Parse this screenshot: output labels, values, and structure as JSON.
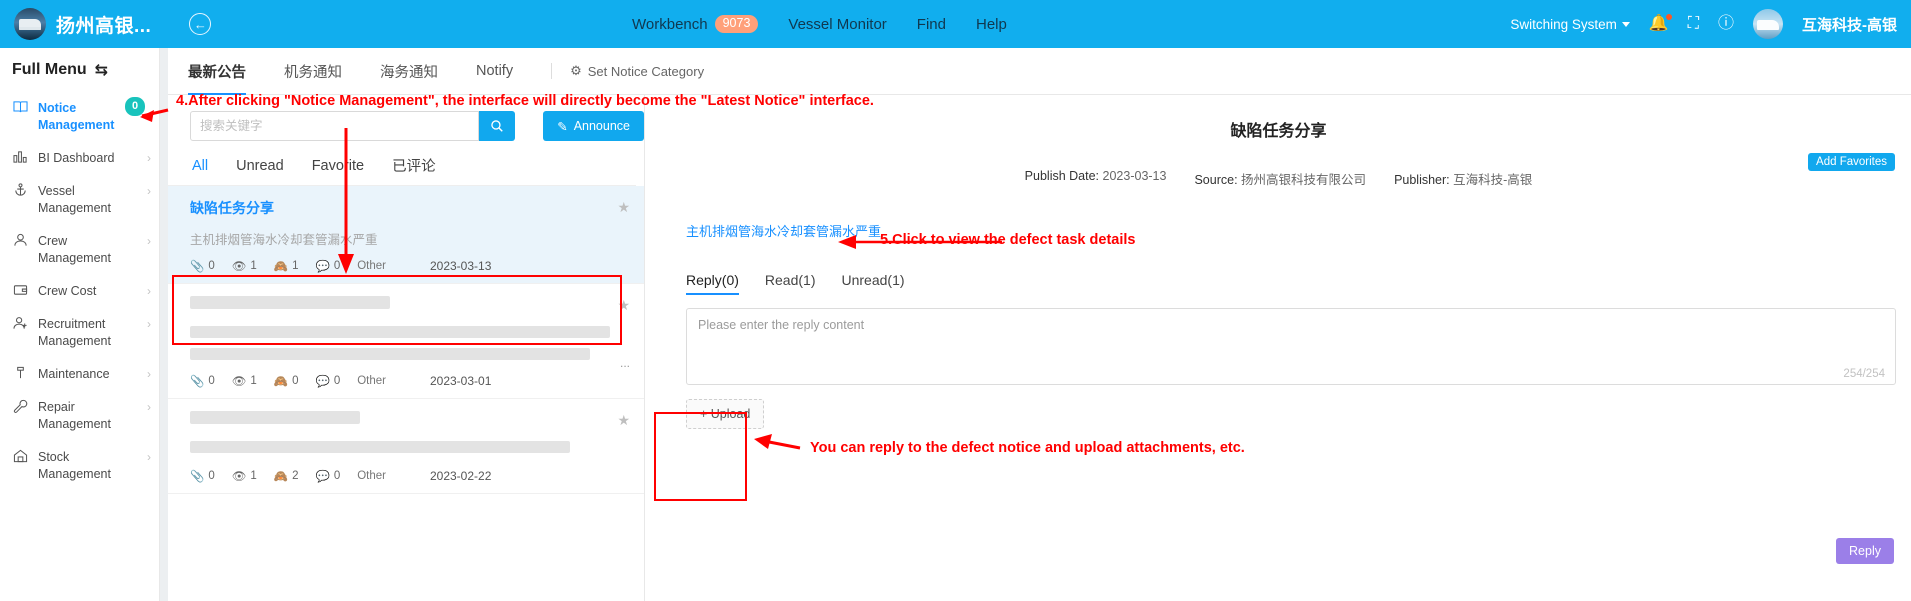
{
  "header": {
    "brand_name": "扬州高银...",
    "logo_icon": "ship-logo",
    "back_icon": "back-arrow-icon",
    "nav": [
      {
        "label": "Workbench",
        "badge": "9073"
      },
      {
        "label": "Vessel Monitor",
        "badge": ""
      },
      {
        "label": "Find",
        "badge": ""
      },
      {
        "label": "Help",
        "badge": ""
      }
    ],
    "switching_system": "Switching System",
    "bell_icon": "bell-icon",
    "fullscreen_icon": "fullscreen-icon",
    "help_icon": "help-circle-icon",
    "user_name": "互海科技-高银",
    "accent_color": "#11aeee"
  },
  "sidebar": {
    "title": "Full Menu",
    "swap_icon": "swap-icon",
    "items": [
      {
        "label": "Notice Management",
        "icon": "book-icon",
        "active": true,
        "badge": "0",
        "chevron": false
      },
      {
        "label": "BI Dashboard",
        "icon": "chart-icon",
        "active": false,
        "badge": "",
        "chevron": true
      },
      {
        "label": "Vessel Management",
        "icon": "anchor-icon",
        "active": false,
        "badge": "",
        "chevron": true
      },
      {
        "label": "Crew Management",
        "icon": "person-icon",
        "active": false,
        "badge": "",
        "chevron": true
      },
      {
        "label": "Crew Cost",
        "icon": "wallet-icon",
        "active": false,
        "badge": "",
        "chevron": true
      },
      {
        "label": "Recruitment Management",
        "icon": "person-add-icon",
        "active": false,
        "badge": "",
        "chevron": true
      },
      {
        "label": "Maintenance",
        "icon": "tool-icon",
        "active": false,
        "badge": "",
        "chevron": true
      },
      {
        "label": "Repair Management",
        "icon": "wrench-icon",
        "active": false,
        "badge": "",
        "chevron": true
      },
      {
        "label": "Stock Management",
        "icon": "warehouse-icon",
        "active": false,
        "badge": "",
        "chevron": true
      }
    ]
  },
  "tabs": [
    {
      "label": "最新公告",
      "active": true
    },
    {
      "label": "机务通知",
      "active": false
    },
    {
      "label": "海务通知",
      "active": false
    },
    {
      "label": "Notify",
      "active": false
    }
  ],
  "tab_setting": {
    "label": "Set Notice Category",
    "icon": "gear-icon"
  },
  "search": {
    "placeholder": "搜索关键字",
    "value": "",
    "search_icon": "search-icon",
    "announce_label": "Announce",
    "announce_icon": "edit-icon"
  },
  "filters": [
    {
      "label": "All",
      "active": true
    },
    {
      "label": "Unread",
      "active": false
    },
    {
      "label": "Favorite",
      "active": false
    },
    {
      "label": "已评论",
      "active": false
    }
  ],
  "notices": [
    {
      "title": "缺陷任务分享",
      "subtitle": "主机排烟管海水冷却套管漏水严重",
      "attachments": "0",
      "reads": "1",
      "unreads": "1",
      "comments": "0",
      "category": "Other",
      "date": "2023-03-13",
      "selected": true,
      "redacted": false
    },
    {
      "title": "",
      "subtitle": "",
      "attachments": "0",
      "reads": "1",
      "unreads": "0",
      "comments": "0",
      "category": "Other",
      "date": "2023-03-01",
      "selected": false,
      "redacted": true
    },
    {
      "title": "",
      "subtitle": "",
      "attachments": "0",
      "reads": "1",
      "unreads": "2",
      "comments": "0",
      "category": "Other",
      "date": "2023-02-22",
      "selected": false,
      "redacted": true
    }
  ],
  "detail": {
    "title": "缺陷任务分享",
    "add_favorites": "Add Favorites",
    "publish_date_label": "Publish Date:",
    "publish_date": "2023-03-13",
    "source_label": "Source:",
    "source": "扬州高银科技有限公司",
    "publisher_label": "Publisher:",
    "publisher": "互海科技-高银",
    "link_text": "主机排烟管海水冷却套管漏水严重",
    "reply_tabs": [
      {
        "label": "Reply(0)",
        "active": true
      },
      {
        "label": "Read(1)",
        "active": false
      },
      {
        "label": "Unread(1)",
        "active": false
      }
    ],
    "reply_placeholder": "Please enter the reply content",
    "char_count": "254/254",
    "upload_label": "+ Upload",
    "reply_button": "Reply"
  },
  "annotations": [
    {
      "id": "a4",
      "text": "4.After clicking \"Notice Management\", the interface will directly become the \"Latest Notice\" interface."
    },
    {
      "id": "a5",
      "text": "5.Click to view the defect task details"
    },
    {
      "id": "a6",
      "text": "You can reply to the defect notice and upload attachments, etc."
    }
  ]
}
